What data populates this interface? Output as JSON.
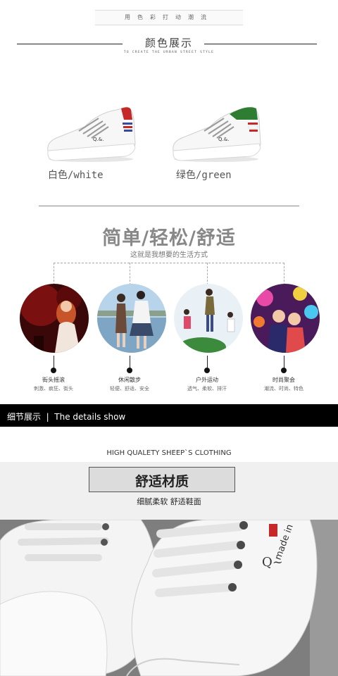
{
  "header": {
    "tagline": "用色彩打动潮流",
    "section_title": "颜色展示",
    "section_subtitle": "TO CREATE THE URBAN STREET STYLE"
  },
  "colors": [
    {
      "label": "白色/white",
      "accent": "#3a4a9a",
      "accent2": "#c62828"
    },
    {
      "label": "绿色/green",
      "accent": "#2e7d32",
      "accent2": "#c62828"
    }
  ],
  "feature": {
    "headline": "简单/轻松/舒适",
    "subline": "这就是我想要的生活方式",
    "items": [
      {
        "title": "街头摇滚",
        "sub": "刺激、疯狂、街头"
      },
      {
        "title": "休闲散步",
        "sub": "轻便、舒适、安全"
      },
      {
        "title": "户外运动",
        "sub": "透气、柔软、排汗"
      },
      {
        "title": "时尚聚会",
        "sub": "潮流、时尚、特色"
      }
    ]
  },
  "details_bar": {
    "text": "细节展示  |  The details show"
  },
  "material": {
    "tagline": "HIGH QUALETY SHEEP`S CLOTHING",
    "title": "舒适材质",
    "subtitle": "细腻柔软  舒适鞋面"
  },
  "shoe_print": {
    "text": "made in"
  }
}
